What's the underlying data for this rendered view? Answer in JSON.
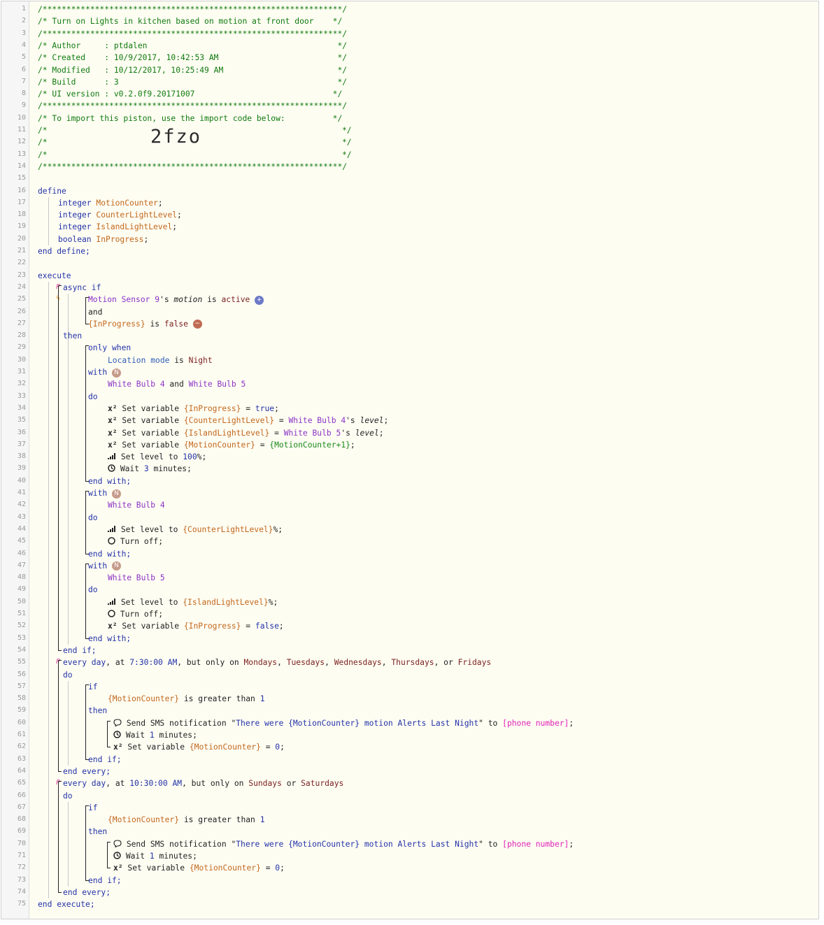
{
  "line_numbers": [
    "1",
    "2",
    "3",
    "4",
    "5",
    "6",
    "7",
    "8",
    "9",
    "10",
    "11",
    "12",
    "13",
    "14",
    "15",
    "16",
    "17",
    "18",
    "19",
    "20",
    "21",
    "22",
    "23",
    "24",
    "25",
    "26",
    "27",
    "28",
    "29",
    "30",
    "31",
    "32",
    "33",
    "34",
    "35",
    "36",
    "37",
    "38",
    "39",
    "40",
    "41",
    "42",
    "43",
    "44",
    "45",
    "46",
    "47",
    "48",
    "49",
    "50",
    "51",
    "52",
    "53",
    "54",
    "55",
    "56",
    "57",
    "58",
    "59",
    "60",
    "61",
    "62",
    "63",
    "64",
    "65",
    "66",
    "67",
    "68",
    "69",
    "70",
    "71",
    "72",
    "73",
    "74",
    "75"
  ],
  "gutter_marks": [
    {
      "line": "24",
      "glyph": "P",
      "kind": "p"
    },
    {
      "line": "25",
      "glyph": "ϟ",
      "kind": "b"
    },
    {
      "line": "55",
      "glyph": "P",
      "kind": "p"
    },
    {
      "line": "65",
      "glyph": "P",
      "kind": "p"
    }
  ],
  "header": {
    "border": "/***************************************************************/",
    "title": "/* Turn on Lights in kitchen based on motion at front door    */",
    "author": "/* Author     : ptdalen                                        */",
    "created": "/* Created    : 10/9/2017, 10:42:53 AM                         */",
    "modified": "/* Modified   : 10/12/2017, 10:25:49 AM                        */",
    "build": "/* Build      : 3                                              */",
    "ui_version": "/* UI version : v0.2.0f9.20171007                             */",
    "import_text": "/* To import this piston, use the import code below:          */",
    "blank_open": "/*",
    "blank_close": "*/",
    "import_code": "2fzo"
  },
  "kw": {
    "define": "define",
    "end_define": "end define;",
    "execute": "execute",
    "end_execute": "end execute;",
    "async_if": "async if",
    "and": "and",
    "then": "then",
    "only_when": "only when",
    "with": "with",
    "do": "do",
    "end_with": "end with;",
    "end_if": "end if;",
    "if": "if",
    "end_every": "end every;",
    "is": "is",
    "is_greater_than": "is greater than"
  },
  "variables": [
    {
      "type": "integer",
      "name": "MotionCounter"
    },
    {
      "type": "integer",
      "name": "CounterLightLevel"
    },
    {
      "type": "integer",
      "name": "IslandLightLevel"
    },
    {
      "type": "boolean",
      "name": "InProgress"
    }
  ],
  "conditions": {
    "motion_device": "Motion Sensor 9",
    "motion_attr": "motion",
    "motion_value": "active",
    "inprogress_var": "{InProgress}",
    "false_value": "false",
    "location_mode": "Location mode",
    "night": "Night"
  },
  "devices": {
    "bulb4": "White Bulb 4",
    "bulb5": "White Bulb 5"
  },
  "actions": {
    "set_variable": "Set variable",
    "set_level_to": "Set level to",
    "wait": "Wait",
    "turn_off": "Turn off;",
    "send_sms": "Send SMS notification",
    "true_value": "true",
    "level_100": "100",
    "wait_3": "3",
    "minutes": "minutes;",
    "wait_1": "1",
    "counter_level_var": "{CounterLightLevel}",
    "island_level_var": "{IslandLightLevel}",
    "motion_counter_var": "{MotionCounter}",
    "motion_counter_expr": "{MotionCounter+1}",
    "level_attr": "level",
    "sms_message": "There were {MotionCounter} motion Alerts Last Night",
    "phone": "[phone number]",
    "zero": "0",
    "one": "1"
  },
  "timers": {
    "weekday": {
      "every_day": "every day",
      "time": "7:30:00 AM",
      "days": [
        "Mondays",
        "Tuesdays",
        "Wednesdays",
        "Thursdays",
        "Fridays"
      ]
    },
    "weekend": {
      "every_day": "every day",
      "time": "10:30:00 AM",
      "days": [
        "Sundays",
        "Saturdays"
      ]
    }
  },
  "badges": {
    "plus": "+",
    "minus": "−",
    "n": "N"
  },
  "icons": {
    "variable": "x²",
    "level": "signal-bars-icon",
    "wait": "clock-icon",
    "power": "power-icon",
    "sms": "chat-bubble-icon"
  }
}
